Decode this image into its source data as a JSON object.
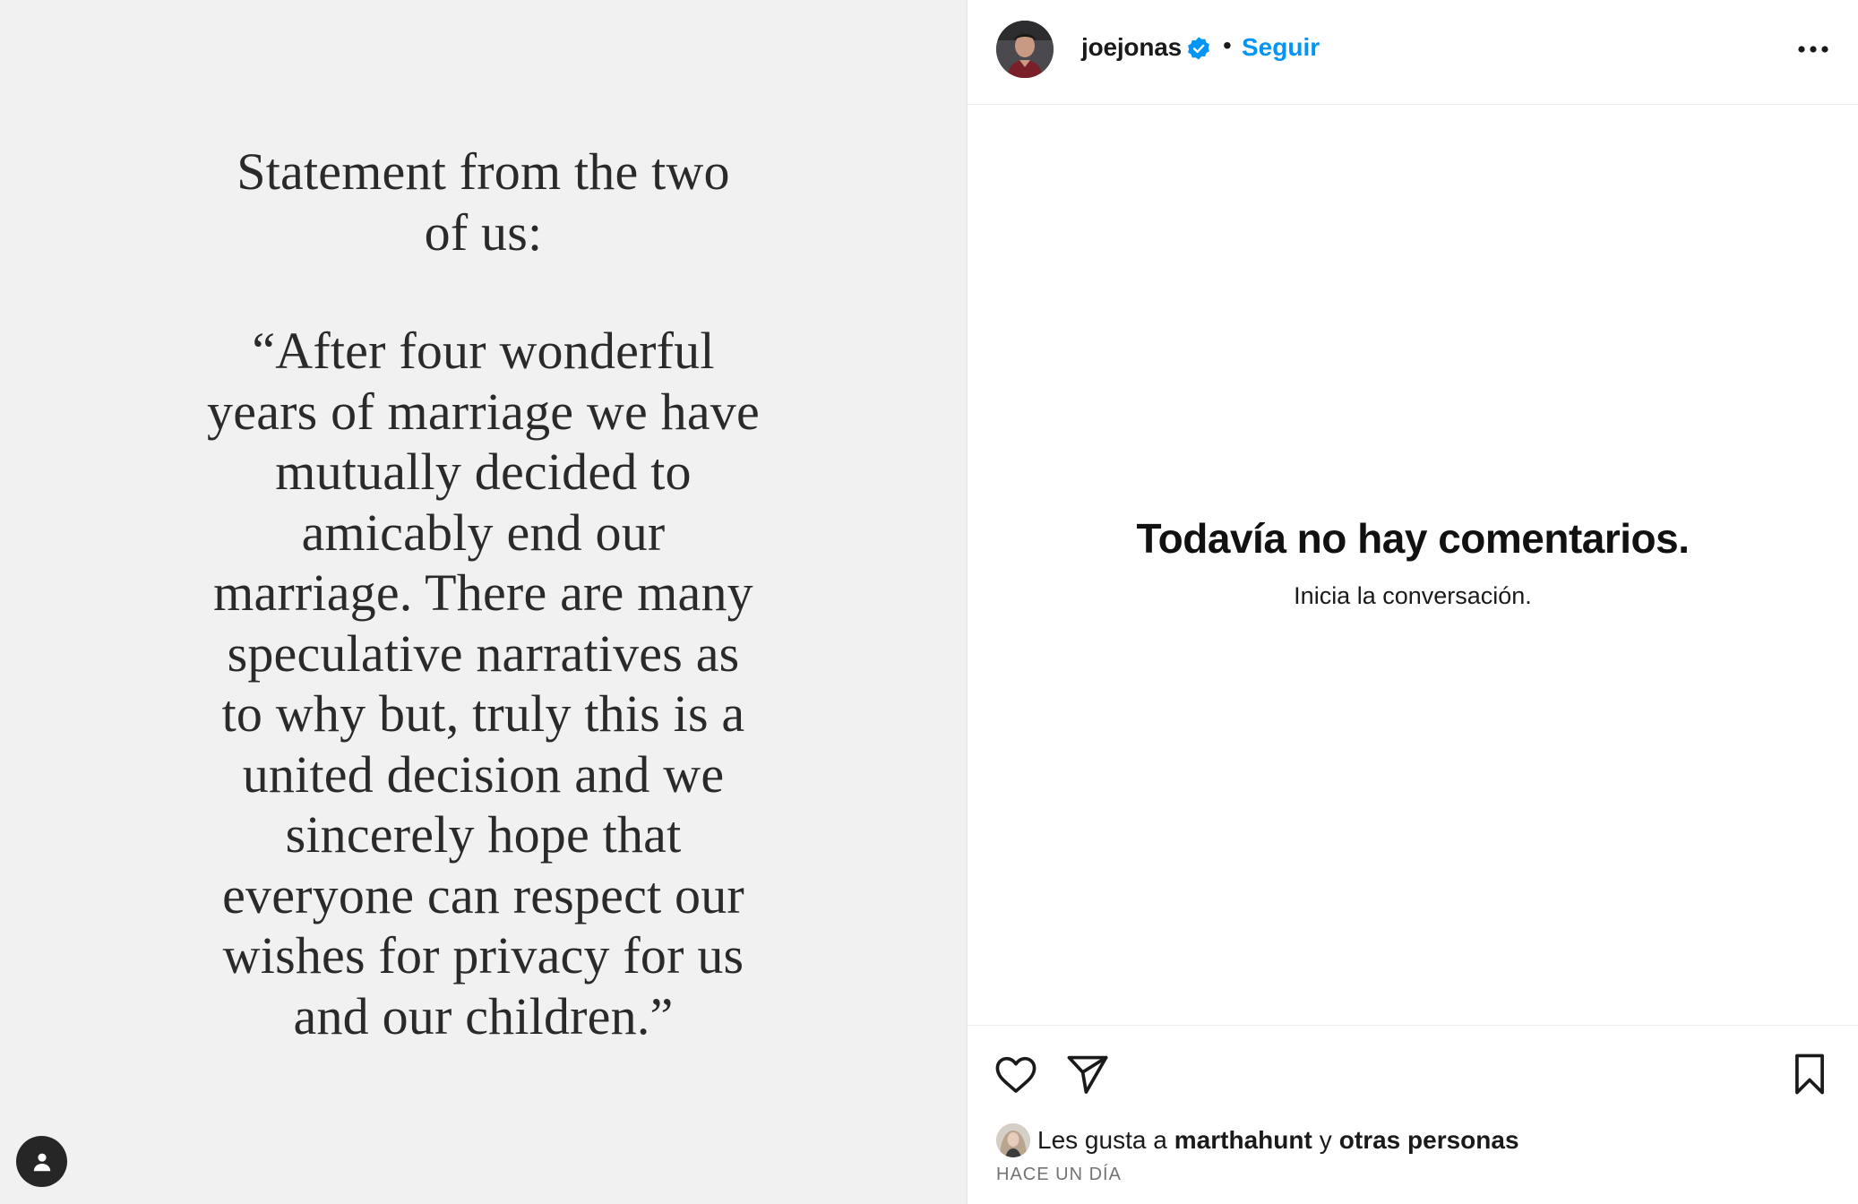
{
  "post": {
    "statement_heading_lines": [
      "Statement from the two",
      "of us:"
    ],
    "statement_quote_lines": [
      "“After four wonderful",
      "years of marriage we have",
      "mutually decided to",
      "amicably end our",
      "marriage. There are many",
      "speculative narratives as",
      "to why but, truly this is a",
      "united decision and we",
      "sincerely hope that",
      "everyone can respect our",
      "wishes for privacy for us",
      "and our children.”"
    ],
    "tag_icon": "user-tag-icon"
  },
  "header": {
    "username": "joejonas",
    "verified_icon": "verified-badge-icon",
    "separator": "•",
    "follow_label": "Seguir",
    "more_icon": "more-options-icon"
  },
  "comments": {
    "empty_title": "Todavía no hay comentarios.",
    "empty_subtitle": "Inicia la conversación."
  },
  "actions": {
    "like_icon": "heart-icon",
    "share_icon": "share-icon",
    "save_icon": "bookmark-icon"
  },
  "likes": {
    "prefix": "Les gusta a",
    "user": "marthahunt",
    "conjunction": "y",
    "others": "otras personas"
  },
  "timestamp": "HACE UN DÍA",
  "colors": {
    "accent": "#0095f6",
    "image_bg": "#f1f1f1",
    "statement_text": "#2a2a2a",
    "muted": "#737373"
  }
}
